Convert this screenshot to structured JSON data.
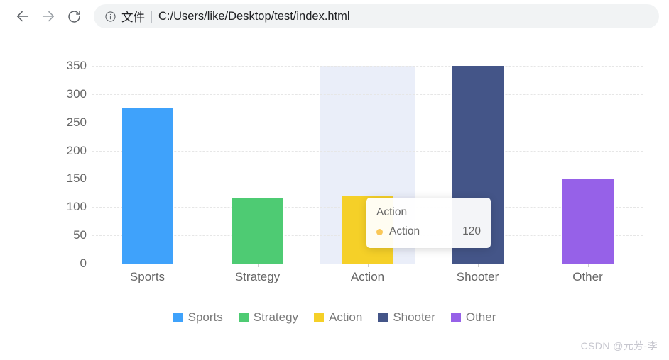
{
  "browser": {
    "back_icon": "arrow-left-icon",
    "forward_icon": "arrow-right-icon",
    "reload_icon": "reload-icon",
    "info_icon": "info-circle-icon",
    "file_scheme_label": "文件",
    "url": "C:/Users/like/Desktop/test/index.html"
  },
  "watermark": {
    "text": "CSDN @元芳-李"
  },
  "tooltip": {
    "title": "Action",
    "series_name": "Action",
    "value": "120",
    "marker_color": "#fac858"
  },
  "colors": {
    "sports": "#3fa2fb",
    "strategy": "#4ecb73",
    "action": "#f5d028",
    "shooter": "#445588",
    "other": "#9661e8",
    "gridline": "#e6e6e6",
    "axis": "#cccccc",
    "axis_text": "#666666",
    "legend_text": "#7a7a7a",
    "hover_band": "#e6ebf8"
  },
  "chart_data": {
    "type": "bar",
    "title": "",
    "xlabel": "",
    "ylabel": "",
    "categories": [
      "Sports",
      "Strategy",
      "Action",
      "Shooter",
      "Other"
    ],
    "values": [
      275,
      115,
      120,
      350,
      150
    ],
    "series": [
      {
        "name": "Sports",
        "values": [
          275
        ],
        "color": "#3fa2fb"
      },
      {
        "name": "Strategy",
        "values": [
          115
        ],
        "color": "#4ecb73"
      },
      {
        "name": "Action",
        "values": [
          120
        ],
        "color": "#f5d028"
      },
      {
        "name": "Shooter",
        "values": [
          350
        ],
        "color": "#445588"
      },
      {
        "name": "Other",
        "values": [
          150
        ],
        "color": "#9661e8"
      }
    ],
    "ylim": [
      0,
      350
    ],
    "yticks": [
      0,
      50,
      100,
      150,
      200,
      250,
      300,
      350
    ],
    "ytick_labels": [
      "0",
      "50",
      "100",
      "150",
      "200",
      "250",
      "300",
      "350"
    ],
    "grid": true,
    "grid_style": "dashed-horizontal",
    "legend_position": "bottom",
    "legend": [
      "Sports",
      "Strategy",
      "Action",
      "Shooter",
      "Other"
    ],
    "highlighted_category": "Action"
  }
}
